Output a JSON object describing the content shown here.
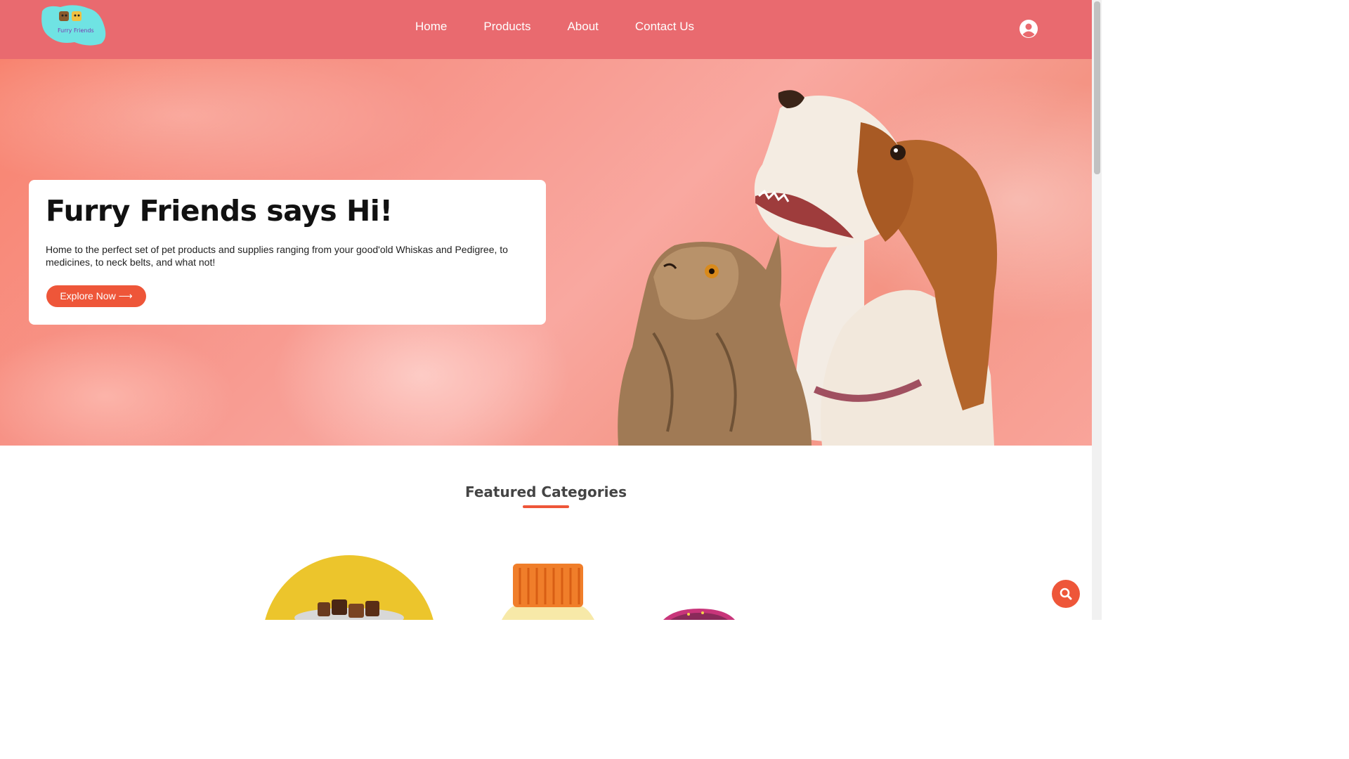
{
  "brand": {
    "logo_text": "Furry Friends"
  },
  "nav": {
    "items": [
      {
        "label": "Home"
      },
      {
        "label": "Products"
      },
      {
        "label": "About"
      },
      {
        "label": "Contact Us"
      }
    ]
  },
  "hero": {
    "title": "Furry Friends says Hi!",
    "description": "Home to the perfect set of pet products and supplies ranging from your good'old Whiskas and Pedigree, to medicines, to neck belts, and what not!",
    "cta_label": "Explore Now ⟶"
  },
  "featured": {
    "title": "Featured Categories"
  },
  "colors": {
    "header": "#e96a6f",
    "accent": "#ee5639",
    "hero": "#f7958a"
  },
  "icons": {
    "user": "user-circle-icon",
    "search": "search-icon"
  }
}
